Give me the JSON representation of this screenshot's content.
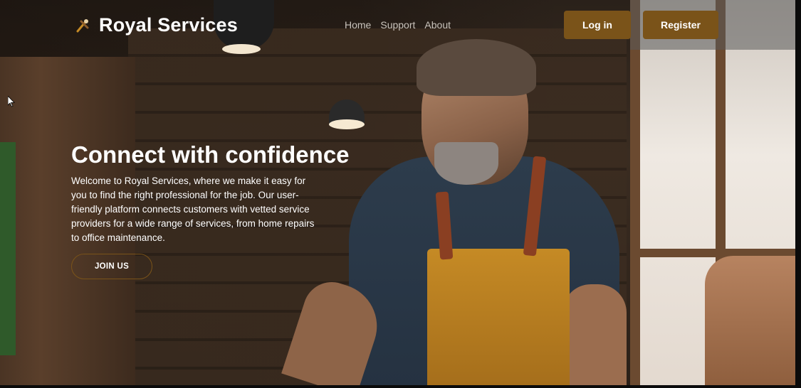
{
  "header": {
    "brand_name": "Royal Services",
    "brand_icon": "broom-tools-icon",
    "nav": [
      {
        "label": "Home"
      },
      {
        "label": "Support"
      },
      {
        "label": "About"
      }
    ],
    "login_label": "Log in",
    "register_label": "Register"
  },
  "hero": {
    "title": "Connect with confidence",
    "description": "Welcome to Royal Services, where we make it easy for you to find the right professional for the job. Our user-friendly platform connects customers with vetted service providers for a wide range of services, from home repairs to office maintenance.",
    "cta_label": "JOIN US",
    "image": "craftsman-in-apron-workshop"
  },
  "colors": {
    "accent": "#7a5319",
    "nav_text": "#c9c3bb",
    "text": "#ffffff"
  }
}
